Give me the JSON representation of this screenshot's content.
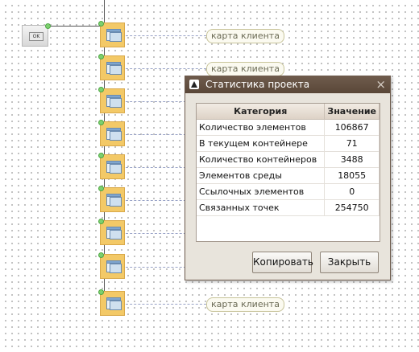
{
  "start_node": {
    "label": "OK"
  },
  "canvas": {
    "node_tag": "карта клиента",
    "node_count": 9
  },
  "dialog": {
    "title": "Статистика проекта",
    "close_glyph": "×",
    "table": {
      "headers": [
        "Категория",
        "Значение"
      ],
      "rows": [
        [
          "Количество элементов",
          "106867"
        ],
        [
          "В текущем контейнере",
          "71"
        ],
        [
          "Количество контейнеров",
          "3488"
        ],
        [
          "Элементов среды",
          "18055"
        ],
        [
          "Ссылочных элементов",
          "0"
        ],
        [
          "Связанных точек",
          "254750"
        ]
      ]
    },
    "buttons": {
      "copy": "Копировать",
      "close": "Закрыть"
    }
  },
  "colors": {
    "titlebar": "#5f4c3d",
    "node_fill": "#f3c967",
    "connector_dot": "#7ed070"
  }
}
